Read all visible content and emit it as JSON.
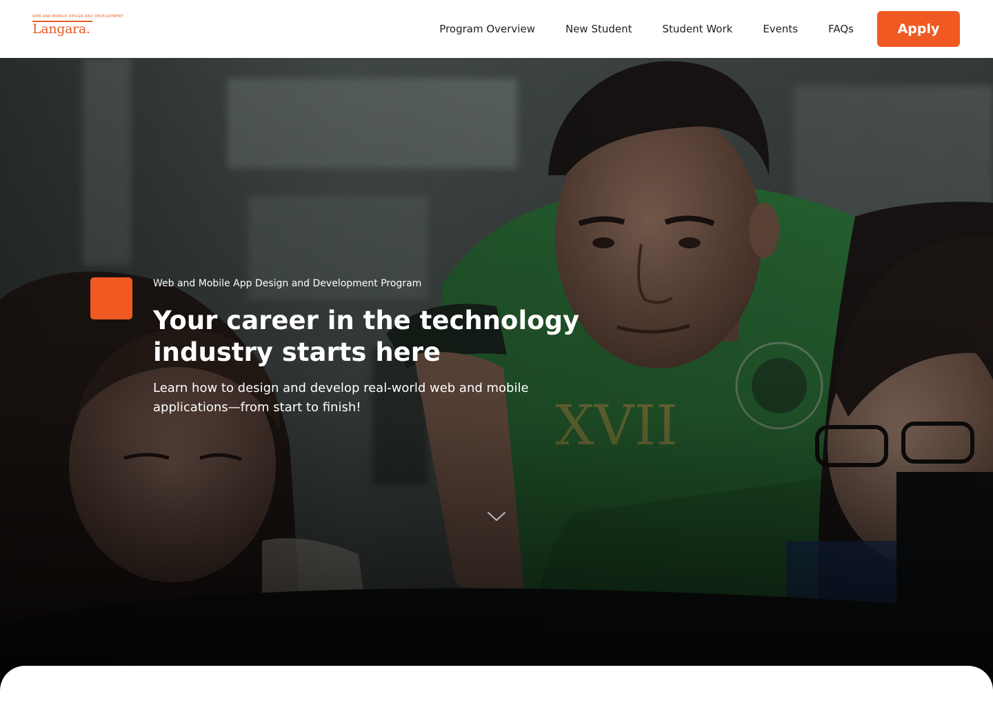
{
  "logo": {
    "tagline": "Web and Mobile Design and Development",
    "wordmark": "Langara."
  },
  "nav": {
    "links": [
      "Program Overview",
      "New Student",
      "Student Work",
      "Events",
      "FAQs"
    ],
    "apply_label": "Apply"
  },
  "hero": {
    "eyebrow": "Web and Mobile App Design and Development Program",
    "title": "Your career in the technology industry starts here",
    "subtitle": "Learn how to design and develop real-world web and mobile applications—from start to finish!"
  },
  "colors": {
    "accent": "#f05a22",
    "logo": "#e85a28",
    "nav_text": "#1f1f1f",
    "hero_text": "#ffffff",
    "shirt": "#2f7a3c"
  },
  "icons": {
    "scroll_cue": "chevron-down-icon"
  }
}
